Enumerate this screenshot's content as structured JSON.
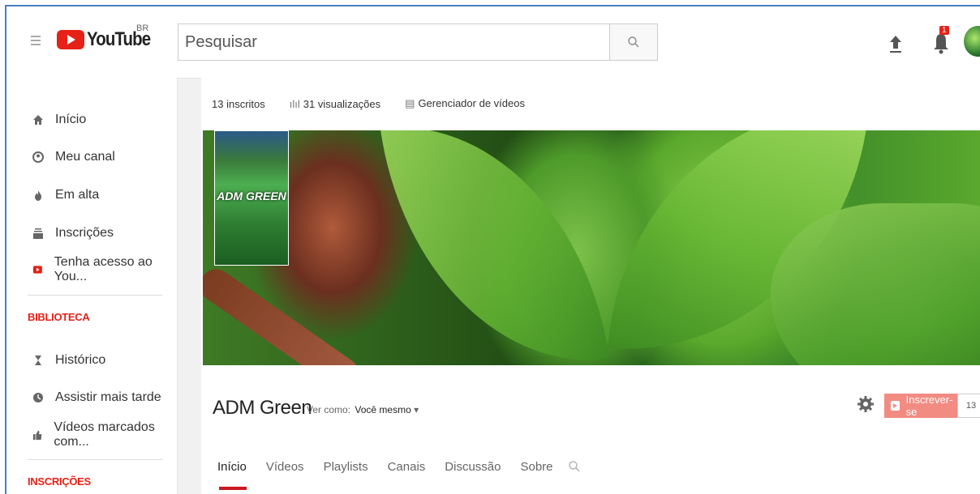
{
  "header": {
    "logo_text": "YouTube",
    "region": "BR",
    "search_placeholder": "Pesquisar",
    "notification_count": "1"
  },
  "sidebar": {
    "items": [
      {
        "label": "Início",
        "icon": "home-icon"
      },
      {
        "label": "Meu canal",
        "icon": "person-icon"
      },
      {
        "label": "Em alta",
        "icon": "flame-icon"
      },
      {
        "label": "Inscrições",
        "icon": "subscriptions-icon"
      },
      {
        "label": "Tenha acesso ao You...",
        "icon": "youtube-red-icon"
      }
    ],
    "library_heading": "BIBLIOTECA",
    "library_items": [
      {
        "label": "Histórico",
        "icon": "hourglass-icon"
      },
      {
        "label": "Assistir mais tarde",
        "icon": "clock-icon"
      },
      {
        "label": "Vídeos marcados com...",
        "icon": "thumbs-up-icon"
      }
    ],
    "subscriptions_heading": "INSCRIÇÕES"
  },
  "channel": {
    "subscribers": "13 inscritos",
    "views": "31 visualizações",
    "video_manager": "Gerenciador de vídeos",
    "thumb_label": "ADM GREEN",
    "name": "ADM Green",
    "view_as_label": "Ver como:",
    "view_as_value": "Você mesmo",
    "subscribe_label": "Inscrever-se",
    "subscribe_count": "13",
    "tabs": [
      "Início",
      "Vídeos",
      "Playlists",
      "Canais",
      "Discussão",
      "Sobre"
    ]
  },
  "colors": {
    "brand_red": "#e62117",
    "subscribe_bg": "#f28b82",
    "tab_underline": "#cc181e"
  }
}
